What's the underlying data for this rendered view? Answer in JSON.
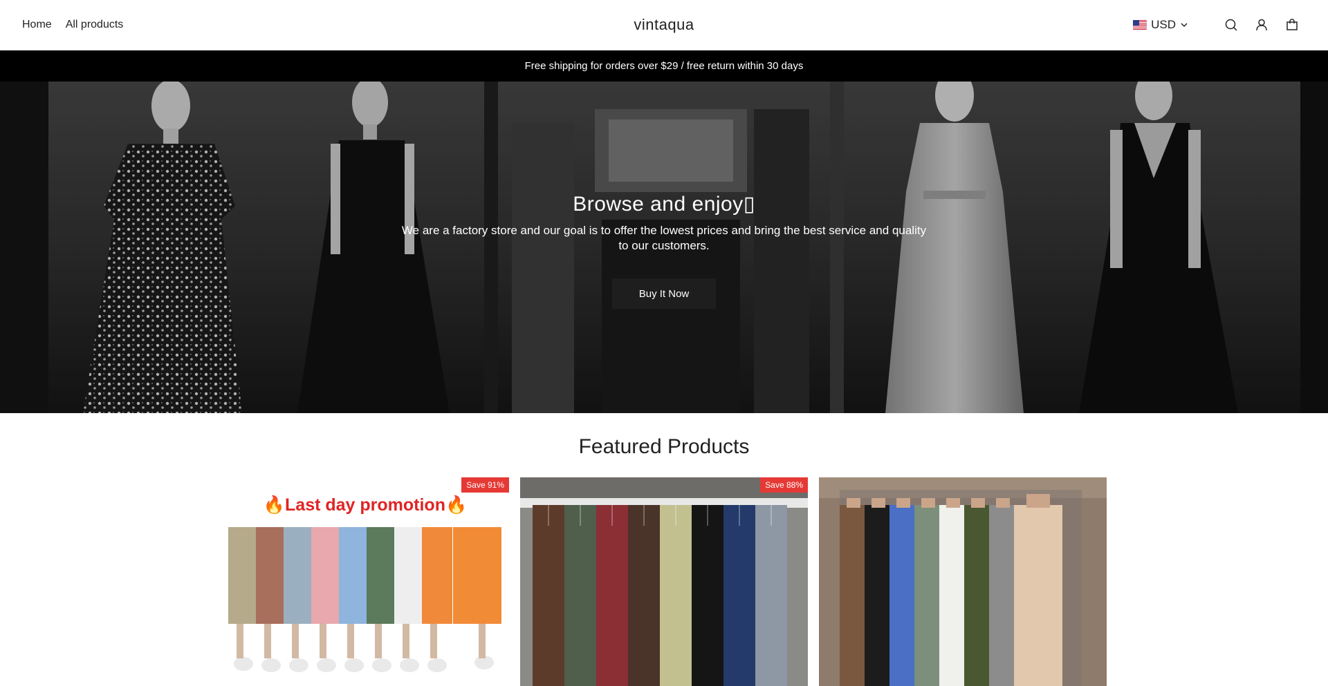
{
  "header": {
    "nav": [
      "Home",
      "All products"
    ],
    "logo": "vintaqua",
    "currency": "USD",
    "icons": [
      "search-icon",
      "account-icon",
      "cart-icon"
    ]
  },
  "announcement": "Free shipping for orders over $29 / free return within 30 days",
  "hero": {
    "title": "Browse and enjoy▯",
    "text": "We are a factory store and our goal is to offer the lowest prices and bring the best service and quality to our customers.",
    "button": "Buy It Now"
  },
  "featured": {
    "title": "Featured Products",
    "products": [
      {
        "badge": "Save 91%",
        "banner": "🔥Last day promotion🔥"
      },
      {
        "badge": "Save 88%"
      },
      {
        "badge": ""
      }
    ]
  },
  "colors": {
    "badge": "#e53935",
    "announcement_bg": "#000000",
    "button_bg": "#1e1e1e"
  }
}
